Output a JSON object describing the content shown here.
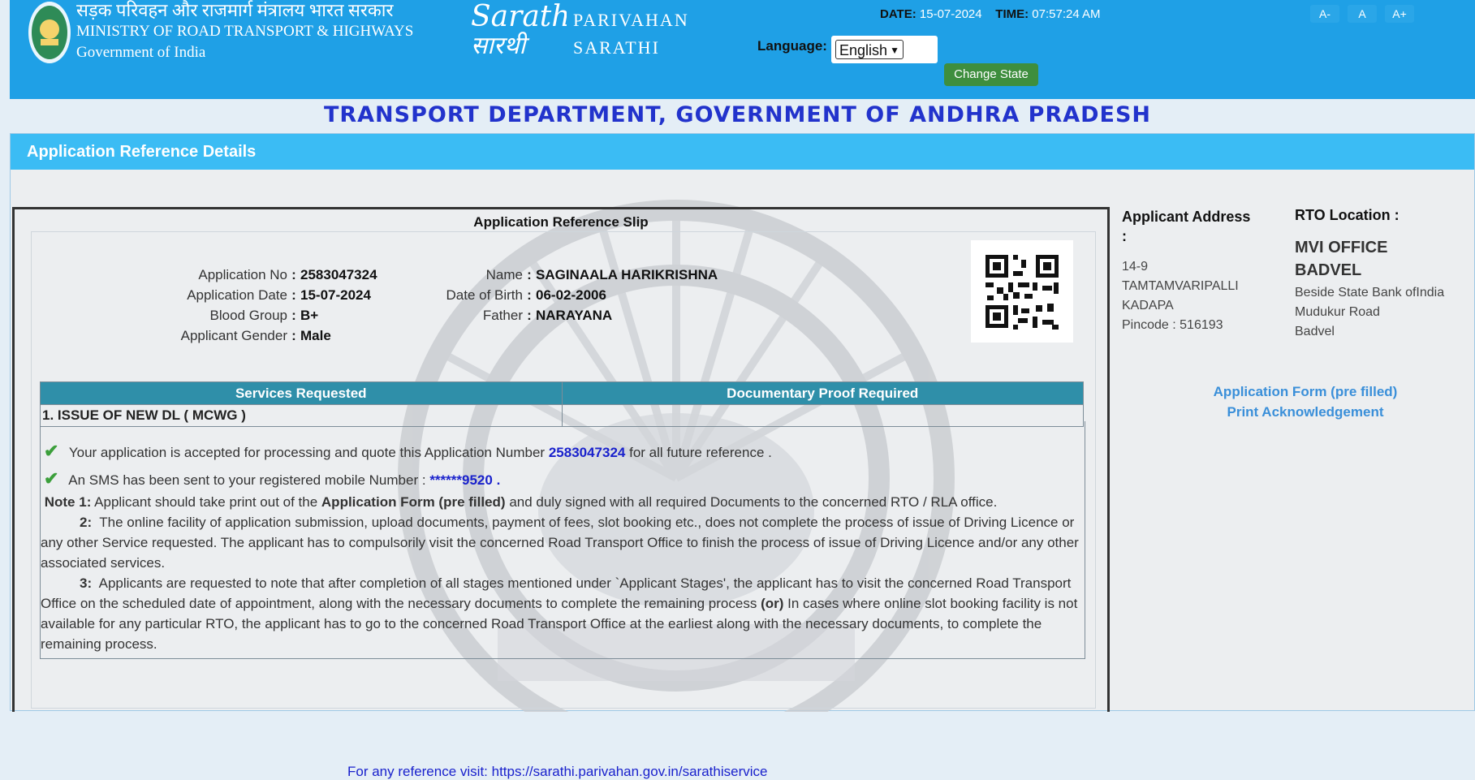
{
  "header": {
    "ministry_hindi": "सड़क परिवहन और राजमार्ग मंत्रालय भारत सरकार",
    "ministry_english": "MINISTRY OF ROAD TRANSPORT & HIGHWAYS",
    "government": "Government of India",
    "logo_text": "Sarathi",
    "brand_line1": "PARIVAHAN",
    "brand_line2": "SARATHI",
    "date_label": "DATE:",
    "date_value": "15-07-2024",
    "time_label": "TIME:",
    "time_value": "07:57:24 AM",
    "font_decrease": "A-",
    "font_normal": "A",
    "font_increase": "A+",
    "language_label": "Language:",
    "language_value": "English",
    "change_state": "Change State"
  },
  "department_title": "TRANSPORT DEPARTMENT, GOVERNMENT OF ANDHRA PRADESH",
  "panel": {
    "title": "Application Reference Details"
  },
  "slip": {
    "title": "Application Reference Slip",
    "left_fields": [
      {
        "label": "Application No",
        "value": "2583047324"
      },
      {
        "label": "Application Date",
        "value": "15-07-2024"
      },
      {
        "label": "Blood Group",
        "value": "B+"
      },
      {
        "label": "Applicant Gender",
        "value": "Male"
      }
    ],
    "right_fields": [
      {
        "label": "Name",
        "value": "SAGINAALA HARIKRISHNA"
      },
      {
        "label": "Date of Birth",
        "value": "06-02-2006"
      },
      {
        "label": "Father",
        "value": "NARAYANA"
      }
    ],
    "table": {
      "headers": [
        "Services Requested",
        "Documentary Proof Required"
      ],
      "rows": [
        [
          "1. ISSUE OF NEW DL ( MCWG )",
          ""
        ]
      ]
    },
    "accept_prefix": "Your application is accepted for processing and quote this Application Number",
    "accept_number": "2583047324",
    "accept_suffix": "for all future reference .",
    "sms_prefix": "An SMS has been sent to your registered mobile Number :",
    "sms_number": "******9520",
    "sms_suffix": ".",
    "note1_label": "Note 1:",
    "note1_a": "Applicant should take print out of the",
    "note1_b": "Application Form (pre filled)",
    "note1_c": "and duly signed with all required Documents to the concerned RTO / RLA office.",
    "note2_label": "2:",
    "note2": "The online facility of application submission, upload documents, payment of fees, slot booking etc., does not complete the process of issue of Driving Licence or any other Service requested. The applicant has to compulsorily visit the concerned Road Transport Office to finish the process of issue of Driving Licence and/or any other associated services.",
    "note3_label": "3:",
    "note3_a": "Applicants are requested to note that after completion of all stages mentioned under `Applicant Stages', the applicant has to visit the concerned Road Transport Office on the scheduled date of appointment, along with the necessary documents to complete the remaining process",
    "note3_or": "(or)",
    "note3_b": "In cases where online slot booking facility is not available for any particular RTO, the applicant has to go to the concerned Road Transport Office at the earliest along with the necessary documents, to complete the remaining process.",
    "reference_visit": "For any reference visit: https://sarathi.parivahan.gov.in/sarathiservice"
  },
  "applicant_address": {
    "label": "Applicant Address",
    "colon": ":",
    "lines": [
      "14-9",
      "TAMTAMVARIPALLI",
      "KADAPA",
      "Pincode : 516193"
    ]
  },
  "rto": {
    "label": "RTO Location :",
    "name_line1": "MVI OFFICE",
    "name_line2": "BADVEL",
    "lines": [
      "Beside State Bank ofIndia",
      "Mudukur Road",
      "Badvel"
    ]
  },
  "links": {
    "application_form": "Application Form (pre filled)",
    "print_ack": "Print Acknowledgement"
  },
  "colors": {
    "header_bg": "#1fa0e6",
    "panel_head": "#3bbcf4",
    "table_head": "#2f8fa9",
    "title_blue": "#2233cc",
    "change_state_green": "#3e8e3e"
  }
}
